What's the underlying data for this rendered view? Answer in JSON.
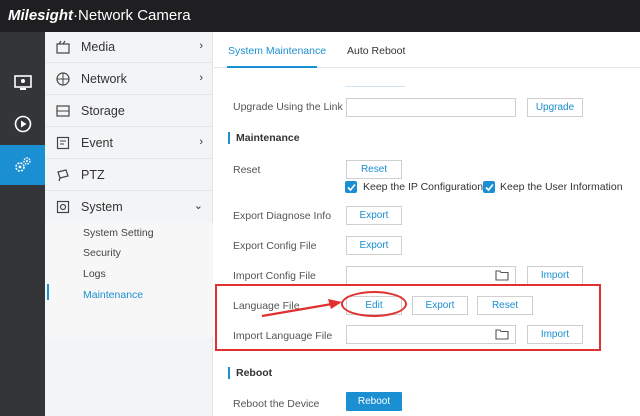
{
  "header": {
    "brand_logo": "Milesight",
    "brand_separator": "·",
    "brand_product": "Network Camera"
  },
  "rail": {
    "icons": [
      "monitor-icon",
      "playback-icon",
      "settings-icon"
    ]
  },
  "sidebar": {
    "items": [
      {
        "label": "Media",
        "icon": "media-icon",
        "chevron": "›"
      },
      {
        "label": "Network",
        "icon": "globe-icon",
        "chevron": "›"
      },
      {
        "label": "Storage",
        "icon": "storage-icon",
        "chevron": ""
      },
      {
        "label": "Event",
        "icon": "event-icon",
        "chevron": "›"
      },
      {
        "label": "PTZ",
        "icon": "ptz-icon",
        "chevron": ""
      },
      {
        "label": "System",
        "icon": "system-icon",
        "chevron": "⌄"
      }
    ],
    "system_sub": [
      "System Setting",
      "Security",
      "Logs",
      "Maintenance"
    ]
  },
  "tabs": {
    "active": "System Maintenance",
    "other": "Auto Reboot"
  },
  "upgrade_link": {
    "label": "Upgrade Using the Link",
    "value": "",
    "button": "Upgrade"
  },
  "maintenance": {
    "title": "Maintenance",
    "reset_label": "Reset",
    "reset_button": "Reset",
    "keep_ip": "Keep the IP Configuration",
    "keep_user": "Keep the User Information",
    "export_diag_label": "Export Diagnose Info",
    "export_diag_button": "Export",
    "export_config_label": "Export Config File",
    "export_config_button": "Export",
    "import_config_label": "Import Config File",
    "import_config_button": "Import",
    "language_label": "Language File",
    "language_edit": "Edit",
    "language_export": "Export",
    "language_reset": "Reset",
    "import_language_label": "Import Language File",
    "import_language_button": "Import"
  },
  "reboot": {
    "title": "Reboot",
    "label": "Reboot the Device",
    "button": "Reboot"
  },
  "colors": {
    "accent": "#1a8fd1",
    "highlight": "#e03030"
  }
}
